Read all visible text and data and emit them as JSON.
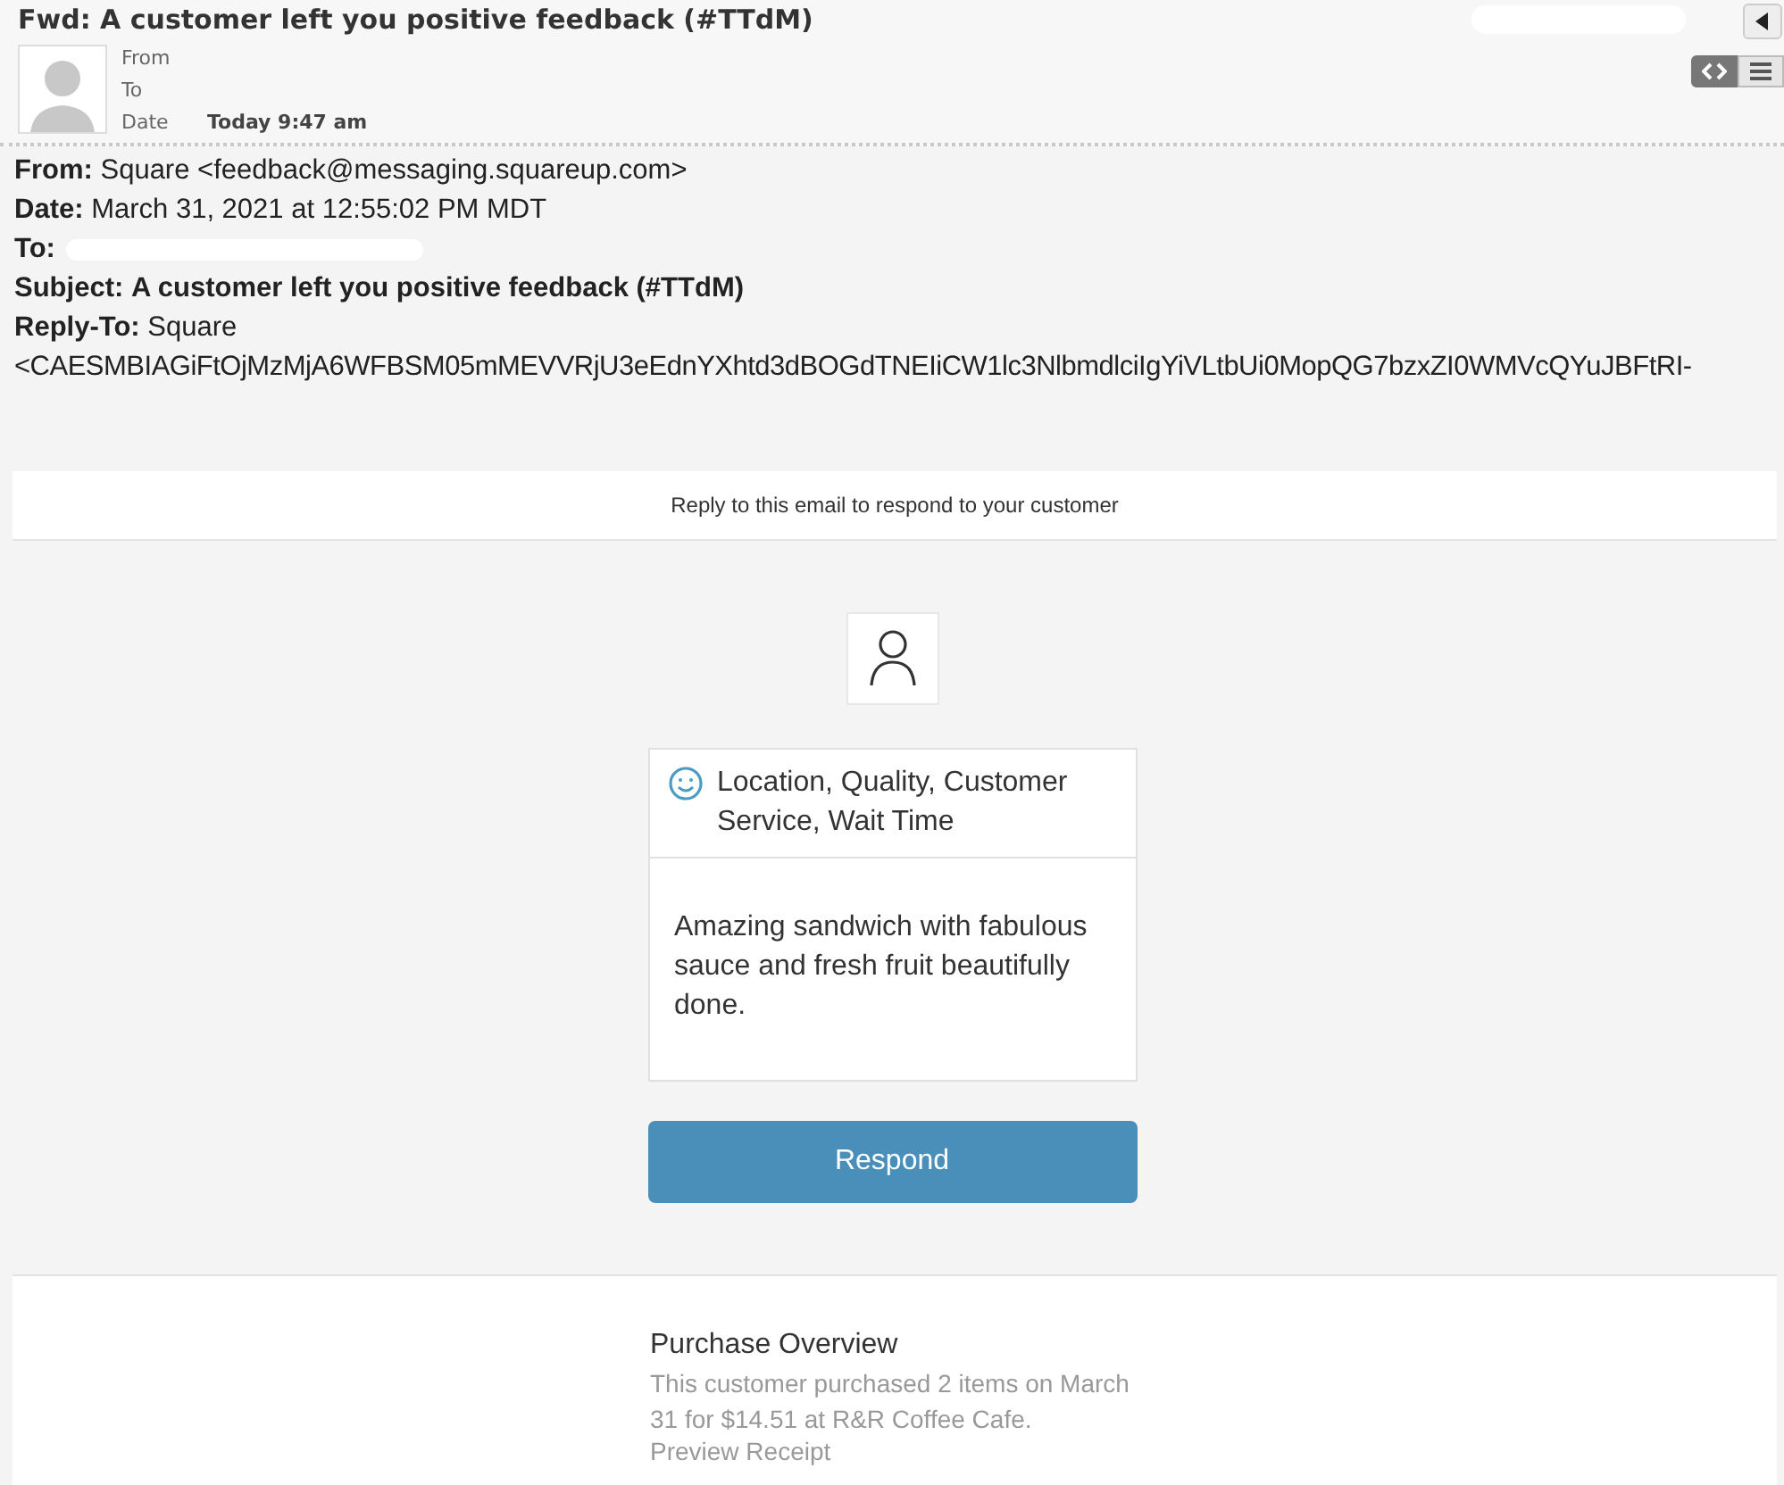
{
  "message_header": {
    "subject": "Fwd: A customer left you positive feedback (#TTdM)",
    "fields": [
      {
        "label": "From"
      },
      {
        "label": "To"
      },
      {
        "label": "Date",
        "value": "Today 9:47 am"
      }
    ],
    "view_toggle": [
      {
        "kind": "code",
        "selected": true
      },
      {
        "kind": "list",
        "selected": false
      }
    ]
  },
  "forwarded_headers": [
    {
      "label": "From:",
      "value": "Square <feedback@messaging.squareup.com>"
    },
    {
      "label": "Date:",
      "value": "March 31, 2021 at 12:55:02 PM MDT"
    },
    {
      "label": "To:"
    },
    {
      "label": "Subject:",
      "value": "A customer left you positive feedback (#TTdM)",
      "bold": true
    },
    {
      "label": "Reply-To:",
      "value": "Square",
      "continuation": "<CAESMBIAGiFtOjMzMjA6WFBSM05mMEVVRjU3eEdnYXhtd3dBOGdTNEIiCW1lc3NlbmdlciIgYiVLtbUi0MopQG7bzxZI0WMVcQYuJBFtRI-"
    }
  ],
  "notice": "Reply to this email to respond to your customer",
  "feedback": {
    "tags": "Location, Quality, Customer Service, Wait Time",
    "comment": "Amazing sandwich with fabulous sauce and fresh fruit beautifully done.",
    "button": "Respond"
  },
  "purchase": {
    "title": "Purchase Overview",
    "text": "This customer purchased 2 items on March 31 for $14.51 at R&R Coffee Cafe.",
    "link": "Preview Receipt"
  }
}
